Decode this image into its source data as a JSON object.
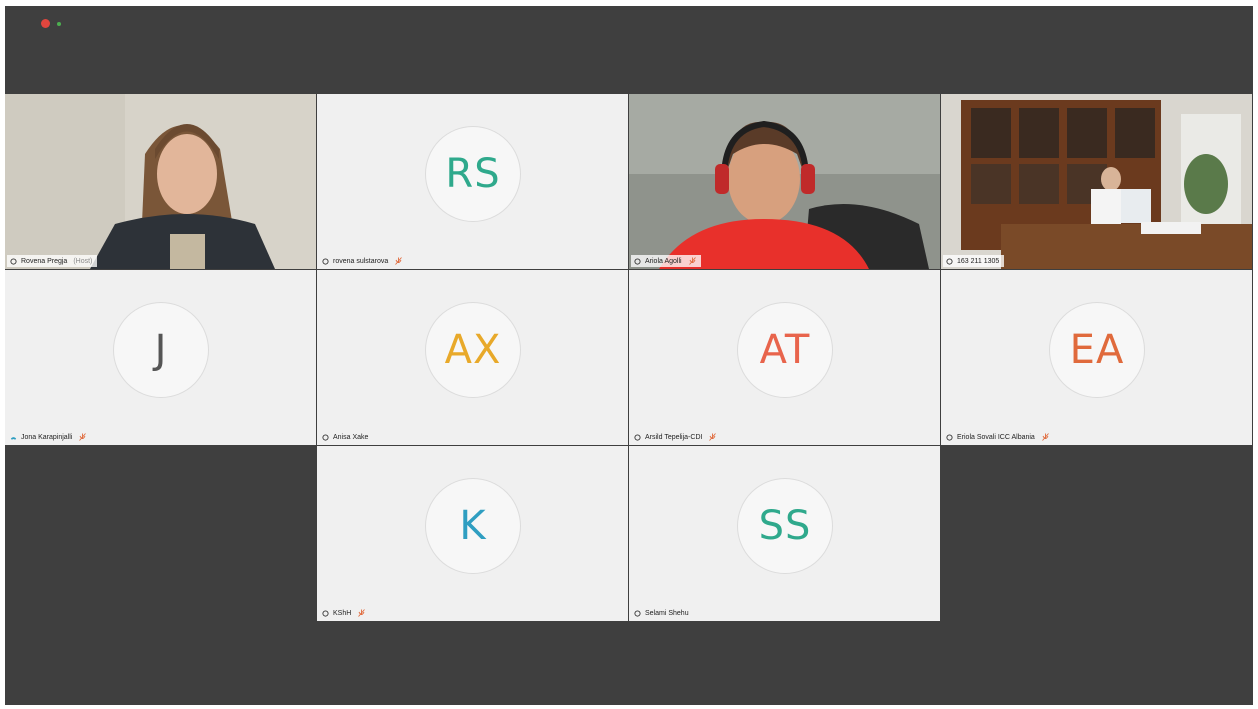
{
  "window": {
    "status_dots": [
      "recording-indicator",
      "connection-indicator"
    ]
  },
  "participants": [
    {
      "name": "Rovena Pregja",
      "suffix": "(Host)",
      "type": "video",
      "muted": false
    },
    {
      "name": "rovena sulstarova",
      "initials": "RS",
      "color": "#2fa98c",
      "type": "avatar",
      "muted": true
    },
    {
      "name": "Ariola Agolli",
      "type": "video",
      "muted": true
    },
    {
      "name": "163 211 1305",
      "type": "video",
      "muted": false,
      "active": true
    },
    {
      "name": "Jona Karapinjalli",
      "initials": "J",
      "color": "#555555",
      "type": "avatar",
      "muted": true
    },
    {
      "name": "Anisa Xake",
      "initials": "AX",
      "color": "#e8a92a",
      "type": "avatar",
      "muted": false
    },
    {
      "name": "Arsild Tepelija-CDI",
      "initials": "AT",
      "color": "#e8644c",
      "type": "avatar",
      "muted": true
    },
    {
      "name": "Eriola Sovali ICC Albania",
      "initials": "EA",
      "color": "#e06a3c",
      "type": "avatar",
      "muted": true
    },
    {
      "name": "KShH",
      "initials": "K",
      "color": "#2f9ec1",
      "type": "avatar",
      "muted": true
    },
    {
      "name": "Selami Shehu",
      "initials": "SS",
      "color": "#2fa98c",
      "type": "avatar",
      "muted": false
    }
  ],
  "colors": {
    "background": "#3f3f3f",
    "tile": "#f0f0f0",
    "active_border": "#3fb7e6",
    "muted": "#e06a3c"
  }
}
